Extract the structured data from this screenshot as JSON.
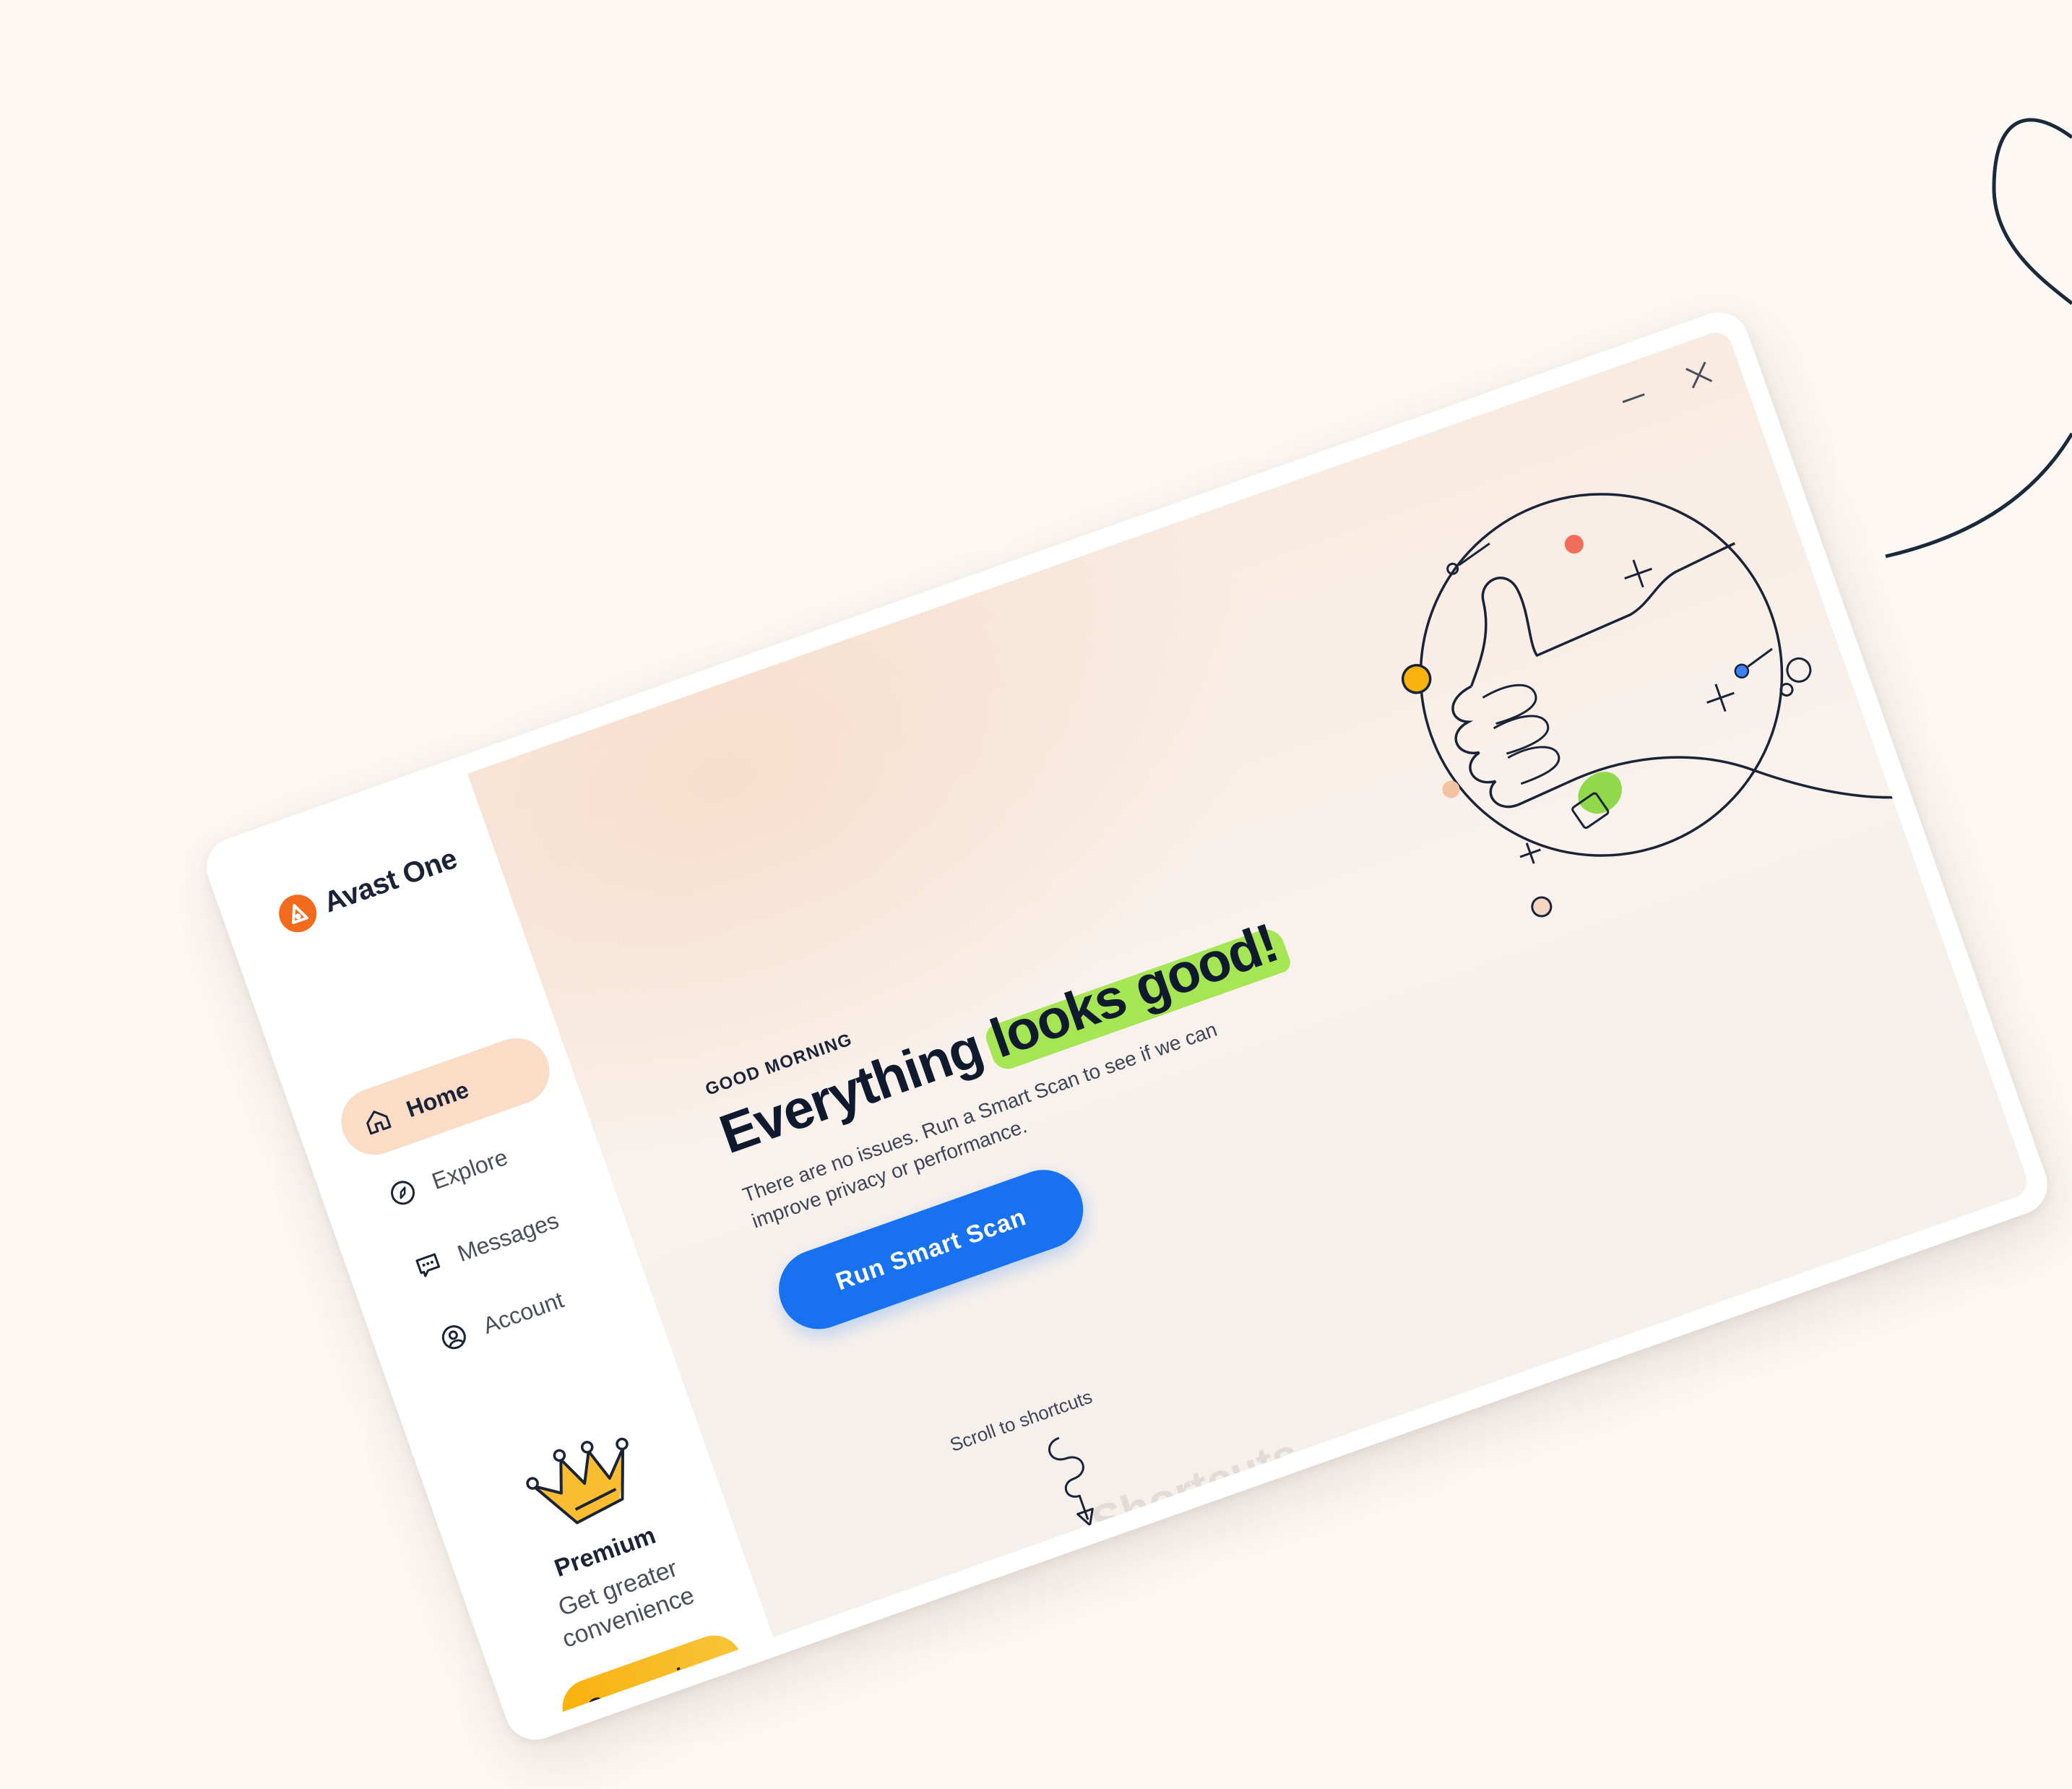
{
  "app": {
    "brand_name": "Avast One",
    "brand_color": "#f26a1b"
  },
  "window_controls": {
    "minimize_icon": "minimize-icon",
    "close_icon": "close-icon"
  },
  "sidebar": {
    "items": [
      {
        "label": "Home",
        "icon": "home-icon",
        "active": true
      },
      {
        "label": "Explore",
        "icon": "compass-icon",
        "active": false
      },
      {
        "label": "Messages",
        "icon": "chat-bubble-icon",
        "active": false
      },
      {
        "label": "Account",
        "icon": "user-circle-icon",
        "active": false
      }
    ],
    "premium": {
      "title": "Premium",
      "description": "Get greater convenience",
      "button_label": "Go premium",
      "icon": "crown-icon",
      "accent": "#f9b20e"
    }
  },
  "main": {
    "greeting": "GOOD MORNING",
    "headline_prefix": "Everything ",
    "headline_highlight": "looks good!",
    "description": "There are no issues. Run a Smart Scan to see if we can improve privacy or performance.",
    "scan_button_label": "Run Smart Scan",
    "scroll_hint": "Scroll to shortcuts",
    "next_section_title": "Shortcuts",
    "illustration": "thumbs-up-illustration",
    "primary_color": "#1872f0",
    "highlight_color": "#a6e553"
  }
}
